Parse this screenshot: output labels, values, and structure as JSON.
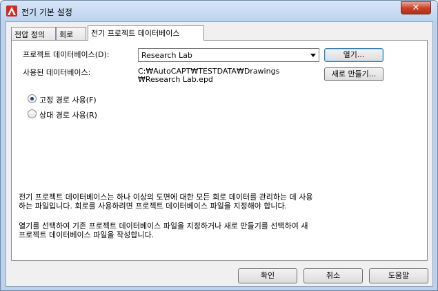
{
  "window": {
    "title": "전기 기본 설정",
    "close_label": "✕"
  },
  "tabs": [
    {
      "label": "전압 정의"
    },
    {
      "label": "회로"
    },
    {
      "label": "전기 프로젝트 데이터베이스"
    }
  ],
  "form": {
    "project_db_label": "프로젝트 데이터베이스(D):",
    "project_db_value": "Research Lab",
    "open_button": "열기...",
    "used_db_label": "사용된 데이터베이스:",
    "used_db_path_line1": "C:₩AutoCAPT₩TESTDATA₩Drawings",
    "used_db_path_line2": "₩Research Lab.epd",
    "new_button": "새로 만들기..."
  },
  "radios": [
    {
      "label": "고정 경로 사용(F)",
      "checked": true
    },
    {
      "label": "상대 경로 사용(R)",
      "checked": false
    }
  ],
  "description": {
    "para1_line1": "전기 프로젝트 데이터베이스는 하나 이상의 도면에 대한 모든 회로 데이터를 관리하는 데 사용",
    "para1_line2": "하는 파일입니다. 회로를 사용하려면 프로젝트 데이터베이스 파일을 지정해야 합니다.",
    "para2_line1": "열기를 선택하여 기존 프로젝트 데이터베이스 파일을 지정하거나 새로 만들기를 선택하여 새",
    "para2_line2": "프로젝트 데이터베이스 파일을 작성합니다."
  },
  "footer": {
    "ok": "확인",
    "cancel": "취소",
    "help": "도움말"
  },
  "colors": {
    "app_icon": "#d22a1e",
    "close_button": "#c8452b"
  }
}
